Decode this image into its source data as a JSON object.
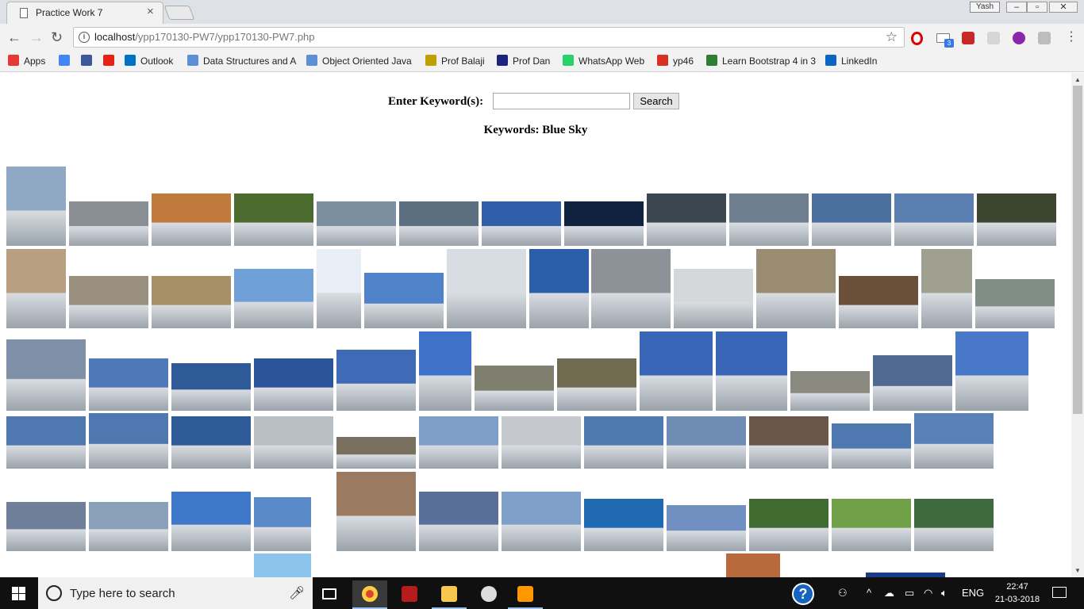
{
  "browser": {
    "tab_title": "Practice Work 7",
    "profile_name": "Yash",
    "url_host": "localhost",
    "url_path": "/ypp170130-PW7/ypp170130-PW7.php",
    "mail_badge": "3",
    "bookmarks": [
      {
        "label": "Apps",
        "icon": "apps-grid-icon",
        "color": "#e53935"
      },
      {
        "label": "",
        "icon": "google-icon",
        "color": "#4285f4"
      },
      {
        "label": "",
        "icon": "facebook-icon",
        "color": "#3b5998"
      },
      {
        "label": "",
        "icon": "youtube-icon",
        "color": "#e62117"
      },
      {
        "label": "Outlook",
        "icon": "outlook-icon",
        "color": "#0072c6"
      },
      {
        "label": "Data Structures and A",
        "icon": "link-icon",
        "color": "#5c8fd6"
      },
      {
        "label": "Object Oriented Java",
        "icon": "link-icon",
        "color": "#5c8fd6"
      },
      {
        "label": "Prof Balaji",
        "icon": "utd-icon",
        "color": "#c0a000"
      },
      {
        "label": "Prof Dan",
        "icon": "person-icon",
        "color": "#1a237e"
      },
      {
        "label": "WhatsApp Web",
        "icon": "whatsapp-icon",
        "color": "#25d366"
      },
      {
        "label": "yp46",
        "icon": "gmail-icon",
        "color": "#d93025"
      },
      {
        "label": "Learn Bootstrap 4 in 3",
        "icon": "bootstrap-icon",
        "color": "#2e7d32"
      },
      {
        "label": "LinkedIn",
        "icon": "linkedin-icon",
        "color": "#0a66c2"
      }
    ]
  },
  "page": {
    "search_label": "Enter Keyword(s):",
    "search_value": "",
    "search_button": "Search",
    "keywords_line": "Keywords: Blue Sky",
    "image_colors": [
      "#8fa8c4",
      "#8a8f96",
      "#c07a3c",
      "#4b6b2e",
      "#7b8fa0",
      "#5c6f80",
      "#2f5fa8",
      "#0f2340",
      "#3c4650",
      "#6f7f90",
      "#4a6f9f",
      "#5a7fb0",
      "#3c4530",
      "#b89f80",
      "#9a9080",
      "#a79065",
      "#6fa0d8",
      "#e8eef5",
      "#4f82c8",
      "#d8dde3",
      "#2b5ea8",
      "#8c9298",
      "#d5d8da",
      "#9a8c70",
      "#6a5038",
      "#a0a090",
      "#7f8f88",
      "#7f90a8",
      "#4f78b8",
      "#2f5a98",
      "#2c5498",
      "#3f6ab8",
      "#3d72c8",
      "#7f7f70",
      "#6f6a50",
      "#3a66b8",
      "#3a66b8",
      "#8a8a80",
      "#4f6a90",
      "#4a78c8",
      "#4f78b0",
      "#4f78b0",
      "#2f5a98",
      "#b8bfc5",
      "#7a7060",
      "#7f9ec8",
      "#c5c8cc",
      "#4f7ab0",
      "#6f8cb5",
      "#6a5548",
      "#4f78b0",
      "#5a80b8",
      "#6f7f9a",
      "#8aa0b8",
      "#3f78c8",
      "#5a8ac8",
      "#9a7a60",
      "#5a6f98",
      "#7fa0c8",
      "#1f6ab0",
      "#6f90c0",
      "#3f6a30",
      "#6fa048",
      "#3f6a3f"
    ]
  }
}
